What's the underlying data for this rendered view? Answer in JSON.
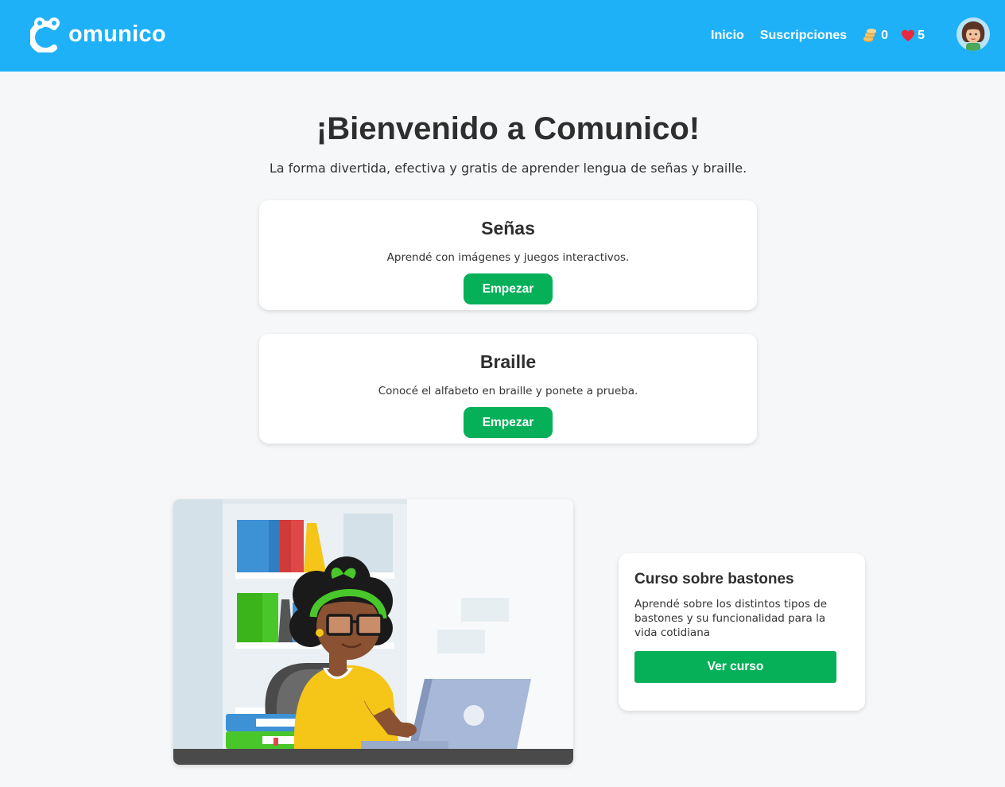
{
  "header": {
    "logo_text": "omunico",
    "nav": {
      "home": "Inicio",
      "subscriptions": "Suscripciones"
    },
    "coins": "0",
    "lives": "5"
  },
  "hero": {
    "title": "¡Bienvenido a Comunico!",
    "subtitle": "La forma divertida, efectiva y gratis de aprender lengua de señas y braille."
  },
  "cards": [
    {
      "title": "Señas",
      "description": "Aprendé con imágenes y juegos interactivos.",
      "button": "Empezar"
    },
    {
      "title": "Braille",
      "description": "Conocé el alfabeto en braille y ponete a prueba.",
      "button": "Empezar"
    }
  ],
  "course": {
    "title": "Curso sobre bastones",
    "description": "Aprendé sobre los distintos tipos de bastones y su funcionalidad para la vida cotidiana",
    "button": "Ver curso"
  },
  "colors": {
    "header": "#1fb1f8",
    "primary_button": "#06b059",
    "background": "#f5f7f9"
  },
  "icons": [
    "logo-icon",
    "coins-icon",
    "heart-icon",
    "avatar",
    "illustration"
  ]
}
